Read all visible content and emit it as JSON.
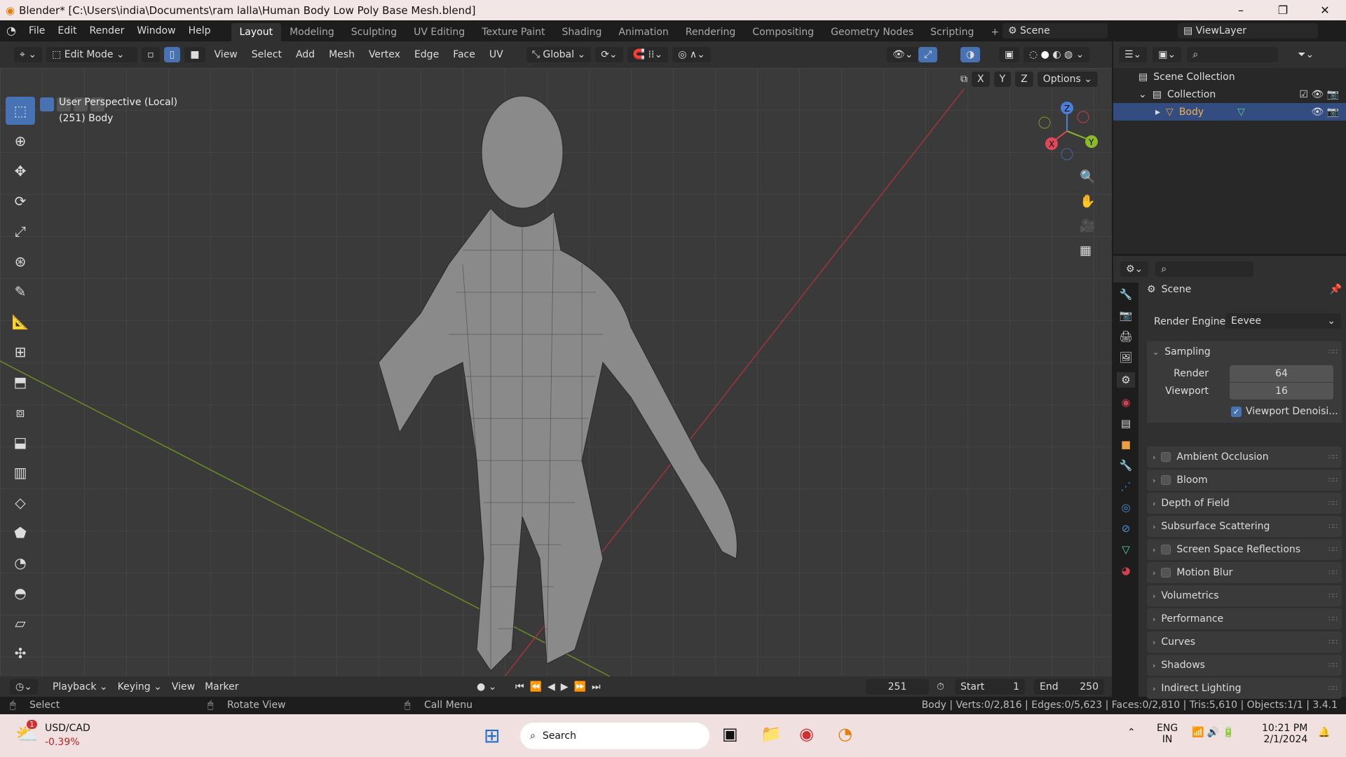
{
  "window": {
    "title": "Blender* [C:\\Users\\india\\Documents\\ram lalla\\Human Body Low Poly Base Mesh.blend]"
  },
  "menu": [
    "File",
    "Edit",
    "Render",
    "Window",
    "Help"
  ],
  "workspaces": [
    "Layout",
    "Modeling",
    "Sculpting",
    "UV Editing",
    "Texture Paint",
    "Shading",
    "Animation",
    "Rendering",
    "Compositing",
    "Geometry Nodes",
    "Scripting"
  ],
  "scene_name": "Scene",
  "view_layer": "ViewLayer",
  "header": {
    "mode": "Edit Mode",
    "menus": [
      "View",
      "Select",
      "Add",
      "Mesh",
      "Vertex",
      "Edge",
      "Face",
      "UV"
    ],
    "orientation": "Global",
    "options": "Options",
    "axes": [
      "X",
      "Y",
      "Z"
    ]
  },
  "viewport": {
    "perspective": "User Perspective (Local)",
    "object": "(251) Body"
  },
  "outliner": {
    "scene_collection": "Scene Collection",
    "collection": "Collection",
    "object": "Body"
  },
  "properties": {
    "title": "Scene",
    "render_engine_label": "Render Engine",
    "render_engine": "Eevee",
    "sampling": "Sampling",
    "render_label": "Render",
    "render_value": "64",
    "viewport_label": "Viewport",
    "viewport_value": "16",
    "denoise": "Viewport Denoisi...",
    "panels": [
      {
        "label": "Ambient Occlusion",
        "checkbox": true
      },
      {
        "label": "Bloom",
        "checkbox": true
      },
      {
        "label": "Depth of Field",
        "checkbox": false
      },
      {
        "label": "Subsurface Scattering",
        "checkbox": false
      },
      {
        "label": "Screen Space Reflections",
        "checkbox": true
      },
      {
        "label": "Motion Blur",
        "checkbox": true
      },
      {
        "label": "Volumetrics",
        "checkbox": false
      },
      {
        "label": "Performance",
        "checkbox": false
      },
      {
        "label": "Curves",
        "checkbox": false
      },
      {
        "label": "Shadows",
        "checkbox": false
      },
      {
        "label": "Indirect Lighting",
        "checkbox": false
      }
    ]
  },
  "timeline": {
    "menus": [
      "Playback",
      "Keying",
      "View",
      "Marker"
    ],
    "current_frame": "251",
    "start_label": "Start",
    "start": "1",
    "end_label": "End",
    "end": "250"
  },
  "status": {
    "select": "Select",
    "rotate": "Rotate View",
    "call_menu": "Call Menu",
    "stats": "Body | Verts:0/2,816 | Edges:0/5,623 | Faces:0/2,810 | Tris:5,610 | Objects:1/1 | 3.4.1"
  },
  "taskbar": {
    "ticker": "USD/CAD",
    "change": "-0.39%",
    "badge": "1",
    "search": "Search",
    "lang1": "ENG",
    "lang2": "IN",
    "time": "10:21 PM",
    "date": "2/1/2024"
  }
}
